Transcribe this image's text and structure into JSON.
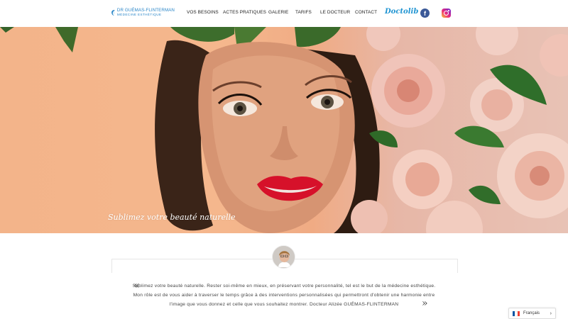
{
  "logo": {
    "name": "DR GUÉMAS-FLINTERMAN",
    "subtitle": "MÉDECINE ESTHÉTIQUE",
    "color": "#2a86c8"
  },
  "nav": {
    "items": [
      {
        "label": "VOS BESOINS"
      },
      {
        "label": "ACTES PRATIQUES"
      },
      {
        "label": "GALERIE"
      },
      {
        "label": "TARIFS"
      },
      {
        "label": "LE DOCTEUR"
      },
      {
        "label": "CONTACT"
      }
    ],
    "doctolib": "Doctolib",
    "facebook_icon": "facebook-icon",
    "instagram_icon": "instagram-icon"
  },
  "hero": {
    "tagline": "Sublimez votre beauté naturelle",
    "background_color": "#f3b48a"
  },
  "intro": {
    "open_quote": "«",
    "close_quote": "»",
    "text": "Sublimez votre beauté naturelle. Rester soi-même en mieux, en préservant votre personnalité, tel est le but de la médecine esthétique. Mon rôle est de vous aider à traverser le temps grâce à des interventions personnalisées qui permettront d'obtenir une harmonie entre l'image que vous donnez et celle que vous souhaitez montrer. Docteur Alizée GUÉMAS-FLINTERMAN"
  },
  "language": {
    "selected": "Français",
    "flag_colors": [
      "#0055a4",
      "#ffffff",
      "#ef4135"
    ]
  }
}
